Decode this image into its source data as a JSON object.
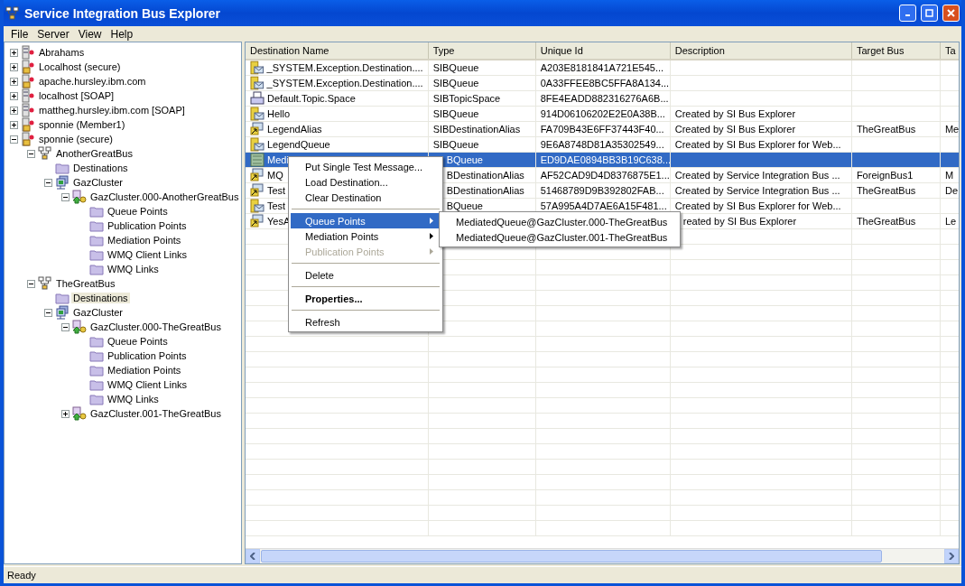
{
  "window": {
    "title": "Service Integration Bus Explorer"
  },
  "menu_bar": [
    {
      "label": "File"
    },
    {
      "label": "Server"
    },
    {
      "label": "View"
    },
    {
      "label": "Help"
    }
  ],
  "tree": [
    {
      "label": "Abrahams",
      "kind": "server",
      "expanded": false,
      "selected": false
    },
    {
      "label": "Localhost (secure)",
      "kind": "secure-server",
      "expanded": false,
      "selected": false
    },
    {
      "label": "apache.hursley.ibm.com",
      "kind": "secure-server",
      "expanded": false,
      "selected": false
    },
    {
      "label": "localhost [SOAP]",
      "kind": "server",
      "expanded": false,
      "selected": false
    },
    {
      "label": "mattheg.hursley.ibm.com [SOAP]",
      "kind": "server",
      "expanded": false,
      "selected": false
    },
    {
      "label": "sponnie (Member1)",
      "kind": "secure-server",
      "expanded": false,
      "selected": false
    },
    {
      "label": "sponnie (secure)",
      "kind": "secure-server",
      "expanded": true,
      "selected": false,
      "children": [
        {
          "label": "AnotherGreatBus",
          "kind": "bus",
          "expanded": true,
          "selected": false,
          "children": [
            {
              "label": "Destinations",
              "kind": "folder",
              "selected": false
            },
            {
              "label": "GazCluster",
              "kind": "cluster",
              "expanded": true,
              "selected": false,
              "children": [
                {
                  "label": "GazCluster.000-AnotherGreatBus",
                  "kind": "engine",
                  "expanded": true,
                  "selected": false,
                  "children": [
                    {
                      "label": "Queue Points",
                      "kind": "folder",
                      "selected": false
                    },
                    {
                      "label": "Publication Points",
                      "kind": "folder",
                      "selected": false
                    },
                    {
                      "label": "Mediation Points",
                      "kind": "folder",
                      "selected": false
                    },
                    {
                      "label": "WMQ Client Links",
                      "kind": "folder",
                      "selected": false
                    },
                    {
                      "label": "WMQ Links",
                      "kind": "folder",
                      "selected": false
                    }
                  ]
                }
              ]
            }
          ]
        },
        {
          "label": "TheGreatBus",
          "kind": "bus",
          "expanded": true,
          "selected": false,
          "children": [
            {
              "label": "Destinations",
              "kind": "folder",
              "selected": true
            },
            {
              "label": "GazCluster",
              "kind": "cluster",
              "expanded": true,
              "selected": false,
              "children": [
                {
                  "label": "GazCluster.000-TheGreatBus",
                  "kind": "engine",
                  "expanded": true,
                  "selected": false,
                  "children": [
                    {
                      "label": "Queue Points",
                      "kind": "folder",
                      "selected": false
                    },
                    {
                      "label": "Publication Points",
                      "kind": "folder",
                      "selected": false
                    },
                    {
                      "label": "Mediation Points",
                      "kind": "folder",
                      "selected": false
                    },
                    {
                      "label": "WMQ Client Links",
                      "kind": "folder",
                      "selected": false
                    },
                    {
                      "label": "WMQ Links",
                      "kind": "folder",
                      "selected": false
                    }
                  ]
                },
                {
                  "label": "GazCluster.001-TheGreatBus",
                  "kind": "engine",
                  "expanded": false,
                  "selected": false
                }
              ]
            }
          ]
        }
      ]
    }
  ],
  "table": {
    "columns": [
      "Destination Name",
      "Type",
      "Unique Id",
      "Description",
      "Target Bus",
      "Ta"
    ],
    "rows": [
      {
        "kind": "queue",
        "selected": false,
        "cells": [
          "_SYSTEM.Exception.Destination....",
          "SIBQueue",
          "A203E8181841A721E545...",
          "",
          "",
          ""
        ]
      },
      {
        "kind": "queue",
        "selected": false,
        "cells": [
          "_SYSTEM.Exception.Destination....",
          "SIBQueue",
          "0A33FFEE8BC5FFA8A134...",
          "",
          "",
          ""
        ]
      },
      {
        "kind": "topic",
        "selected": false,
        "cells": [
          "Default.Topic.Space",
          "SIBTopicSpace",
          "8FE4EADD882316276A6B...",
          "",
          "",
          ""
        ]
      },
      {
        "kind": "queue",
        "selected": false,
        "cells": [
          "Hello",
          "SIBQueue",
          "914D06106202E2E0A38B...",
          "Created by SI Bus Explorer",
          "",
          ""
        ]
      },
      {
        "kind": "alias",
        "selected": false,
        "cells": [
          "LegendAlias",
          "SIBDestinationAlias",
          "FA709B43E6FF37443F40...",
          "Created by SI Bus Explorer",
          "TheGreatBus",
          "Me"
        ]
      },
      {
        "kind": "queue",
        "selected": false,
        "cells": [
          "LegendQueue",
          "SIBQueue",
          "9E6A8748D81A35302549...",
          "Created by SI Bus Explorer for Web...",
          "",
          ""
        ]
      },
      {
        "kind": "mediated",
        "selected": true,
        "cells": [
          "Medi",
          "BQueue",
          "ED9DAE0894BB3B19C638...",
          "",
          "",
          ""
        ]
      },
      {
        "kind": "alias",
        "selected": false,
        "cells": [
          "MQ",
          "BDestinationAlias",
          "AF52CAD9D4D8376875E1...",
          "Created by Service Integration Bus ...",
          "ForeignBus1",
          "M"
        ]
      },
      {
        "kind": "alias",
        "selected": false,
        "cells": [
          "Test",
          "BDestinationAlias",
          "51468789D9B392802FAB...",
          "Created by Service Integration Bus ...",
          "TheGreatBus",
          "De"
        ]
      },
      {
        "kind": "queue",
        "selected": false,
        "cells": [
          "Test",
          "BQueue",
          "57A995A4D7AE6A15F481...",
          "Created by SI Bus Explorer for Web...",
          "",
          ""
        ]
      },
      {
        "kind": "alias",
        "selected": false,
        "cells": [
          "YesA",
          "",
          "",
          "reated by SI Bus Explorer",
          "TheGreatBus",
          "Le"
        ]
      }
    ]
  },
  "context_menu": [
    {
      "kind": "item",
      "label": "Put Single Test Message..."
    },
    {
      "kind": "item",
      "label": "Load Destination..."
    },
    {
      "kind": "item",
      "label": "Clear Destination"
    },
    {
      "kind": "separator"
    },
    {
      "kind": "submenu",
      "label": "Queue Points",
      "selected": true,
      "disabled": false
    },
    {
      "kind": "submenu",
      "label": "Mediation Points",
      "selected": false,
      "disabled": false
    },
    {
      "kind": "submenu",
      "label": "Publication Points",
      "selected": false,
      "disabled": true
    },
    {
      "kind": "separator"
    },
    {
      "kind": "item",
      "label": "Delete"
    },
    {
      "kind": "separator"
    },
    {
      "kind": "default",
      "label": "Properties..."
    },
    {
      "kind": "separator"
    },
    {
      "kind": "item",
      "label": "Refresh"
    }
  ],
  "submenu": [
    "MediatedQueue@GazCluster.000-TheGreatBus",
    "MediatedQueue@GazCluster.001-TheGreatBus"
  ],
  "status_bar": {
    "text": "Ready"
  }
}
